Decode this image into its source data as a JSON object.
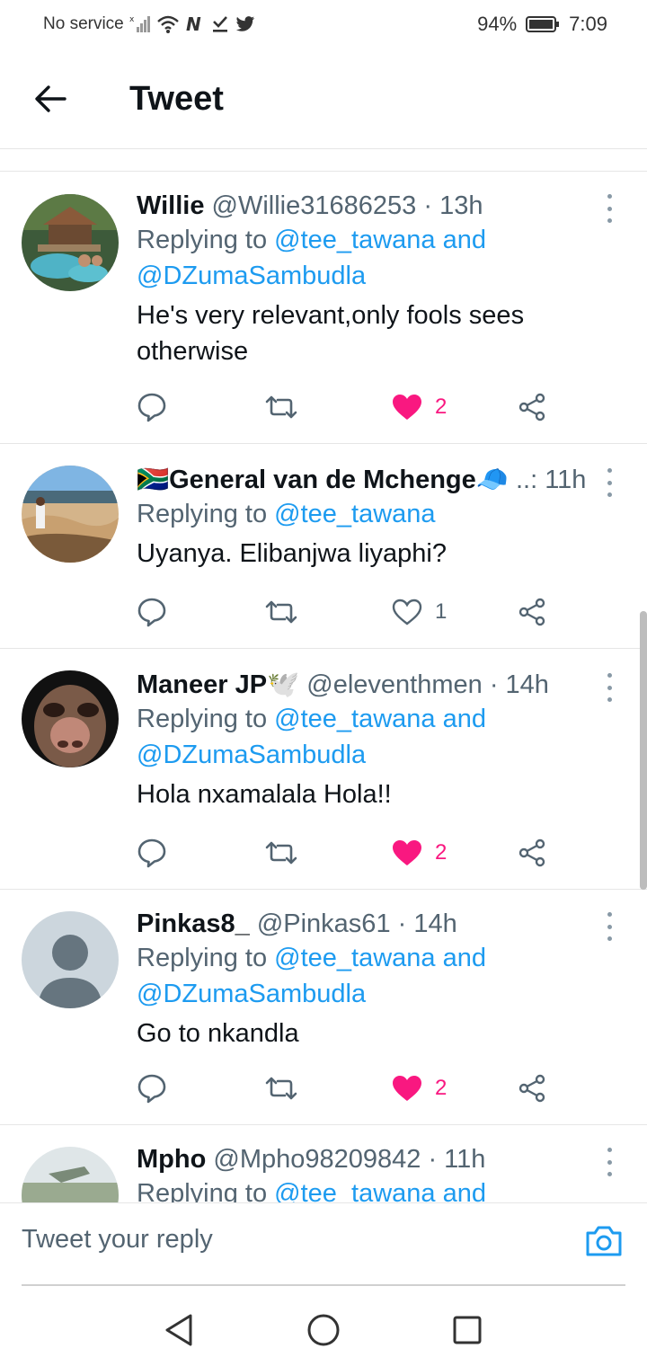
{
  "status_bar": {
    "carrier": "No service",
    "battery": "94%",
    "time": "7:09"
  },
  "header": {
    "title": "Tweet",
    "back_icon": "arrow-left-icon"
  },
  "tweets": [
    {
      "name": "Willie",
      "handle": "@Willie31686253",
      "time": "· 13h",
      "replying_prefix": "Replying to",
      "replying_line1_mention": "@tee_tawana and",
      "replying_line2_mention": "@DZumaSambudla",
      "text_line1": "He's very relevant,only fools sees",
      "text_line2": "otherwise",
      "likes": "2",
      "liked": true
    },
    {
      "name": "General van de Mchenge",
      "name_prefix_emoji": "🇿🇦",
      "name_suffix_emoji": "🧢",
      "handle": "..:",
      "time": "11h",
      "replying_prefix": "Replying to",
      "replying_line1_mention": "@tee_tawana",
      "text_line1": "Uyanya. Elibanjwa liyaphi?",
      "likes": "1",
      "liked": false
    },
    {
      "name": "Maneer JP",
      "name_suffix_emoji": "🕊️",
      "handle": "@eleventhmen",
      "time": "· 14h",
      "replying_prefix": "Replying to",
      "replying_line1_mention": "@tee_tawana and",
      "replying_line2_mention": "@DZumaSambudla",
      "text_line1": "Hola nxamalala Hola!!",
      "likes": "2",
      "liked": true
    },
    {
      "name": "Pinkas8_",
      "handle": "@Pinkas61",
      "time": "· 14h",
      "replying_prefix": "Replying to",
      "replying_line1_mention": "@tee_tawana and",
      "replying_line2_mention": "@DZumaSambudla",
      "text_line1": "Go to nkandla",
      "likes": "2",
      "liked": true
    },
    {
      "name": "Mpho",
      "handle": "@Mpho98209842",
      "time": "· 11h",
      "replying_prefix": "Replying to",
      "replying_line1_mention": "@tee_tawana and"
    }
  ],
  "reply_box": {
    "placeholder": "Tweet your reply",
    "camera_icon": "camera-icon"
  },
  "colors": {
    "accent": "#1d9bf0",
    "like": "#f91880",
    "secondary_text": "#536471"
  }
}
